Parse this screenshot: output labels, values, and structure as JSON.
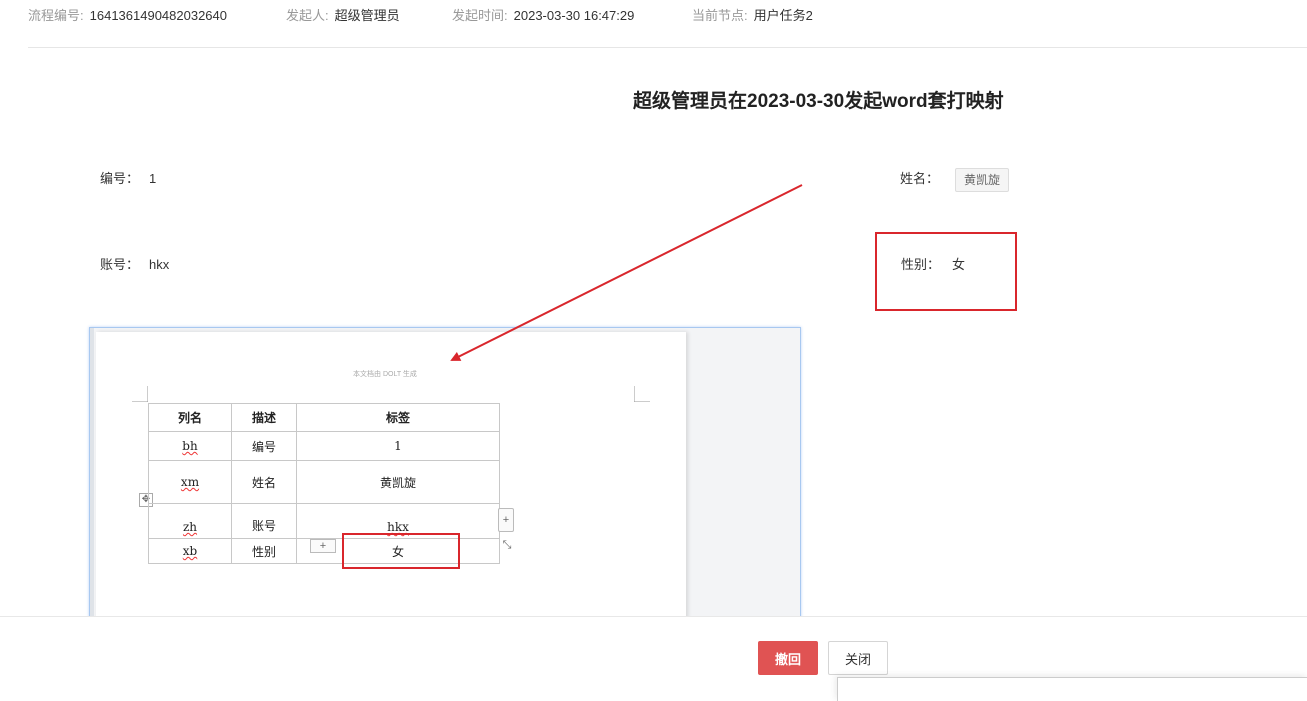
{
  "meta": {
    "process_no_label": "流程编号:",
    "process_no_value": "1641361490482032640",
    "initiator_label": "发起人:",
    "initiator_value": "超级管理员",
    "start_time_label": "发起时间:",
    "start_time_value": "2023-03-30 16:47:29",
    "current_node_label": "当前节点:",
    "current_node_value": "用户任务2"
  },
  "form": {
    "title": "超级管理员在2023-03-30发起word套打映射",
    "fields": {
      "number_label": "编号：",
      "number_value": "1",
      "name_label": "姓名：",
      "name_value": "黄凯旋",
      "account_label": "账号：",
      "account_value": "hkx",
      "gender_label": "性别：",
      "gender_value": "女"
    }
  },
  "document": {
    "header_text": "本文档由 DOLT 生成",
    "table": {
      "headers": [
        "列名",
        "描述",
        "标签"
      ],
      "rows": [
        {
          "col": "bh",
          "desc": "编号",
          "tag": "1"
        },
        {
          "col": "xm",
          "desc": "姓名",
          "tag": "黄凯旋"
        },
        {
          "col": "zh",
          "desc": "账号",
          "tag": "hkx"
        },
        {
          "col": "xb",
          "desc": "性别",
          "tag": "女"
        }
      ]
    },
    "add_row_symbol": "+",
    "add_col_symbol": "+",
    "move_symbol": "✥",
    "resize_symbol": "⤡"
  },
  "actions": {
    "revoke_label": "撤回",
    "close_label": "关闭"
  },
  "colors": {
    "annotation_red": "#d9262c",
    "revoke_bg": "#e05353"
  }
}
